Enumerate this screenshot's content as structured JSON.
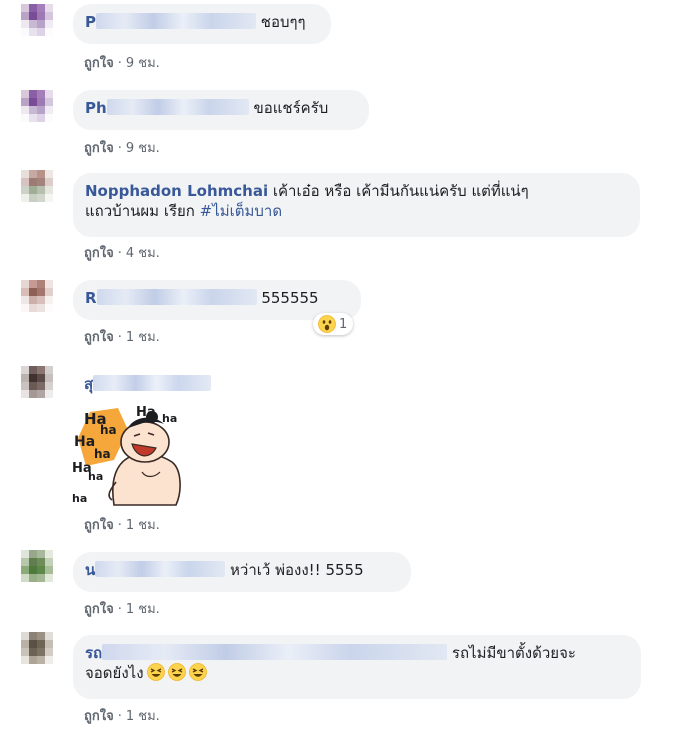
{
  "comments": [
    {
      "name": "P",
      "text": "ชอบๆๆ",
      "like_label": "ถูกใจ",
      "time": "9 ชม."
    },
    {
      "name": "Ph",
      "text": "ขอแชร์ครับ",
      "like_label": "ถูกใจ",
      "time": "9 ชม."
    },
    {
      "name": "Nopphadon Lohmchai",
      "text_line1": "เค้าเอ๋อ หรือ เค้ามีนกันแน่ครับ แต่ที่แน่ๆ",
      "text_line2": "แถวบ้านผม เรียก",
      "hashtag": "#ไม่เต็มบาด",
      "like_label": "ถูกใจ",
      "time": "4 ชม."
    },
    {
      "name": "R",
      "text": "555555",
      "reaction_icon": "wow-reaction-icon",
      "reaction_count": "1",
      "like_label": "ถูกใจ",
      "time": "1 ชม."
    },
    {
      "name": "สุ",
      "sticker": "laughing-man-sticker",
      "sticker_text": [
        "Ha",
        "ha",
        "Ha",
        "ha",
        "Ha",
        "ha",
        "ha",
        "Ha",
        "ha"
      ],
      "like_label": "ถูกใจ",
      "time": "1 ชม."
    },
    {
      "name": "น",
      "text": "หว่าเว้ พ่องง!! 5555",
      "like_label": "ถูกใจ",
      "time": "1 ชม."
    },
    {
      "name": "รถ",
      "text_line1": "รถไม่มีขาตั้งด้วยจะ",
      "text_line2": "จอดยังไง",
      "emoji_icon": "laughing-emoji-icon",
      "like_label": "ถูกใจ",
      "time": "1 ชม."
    }
  ],
  "meta_separator": "·",
  "colors": {
    "name": "#385898",
    "bubble": "#f2f3f5",
    "meta": "#606770"
  }
}
